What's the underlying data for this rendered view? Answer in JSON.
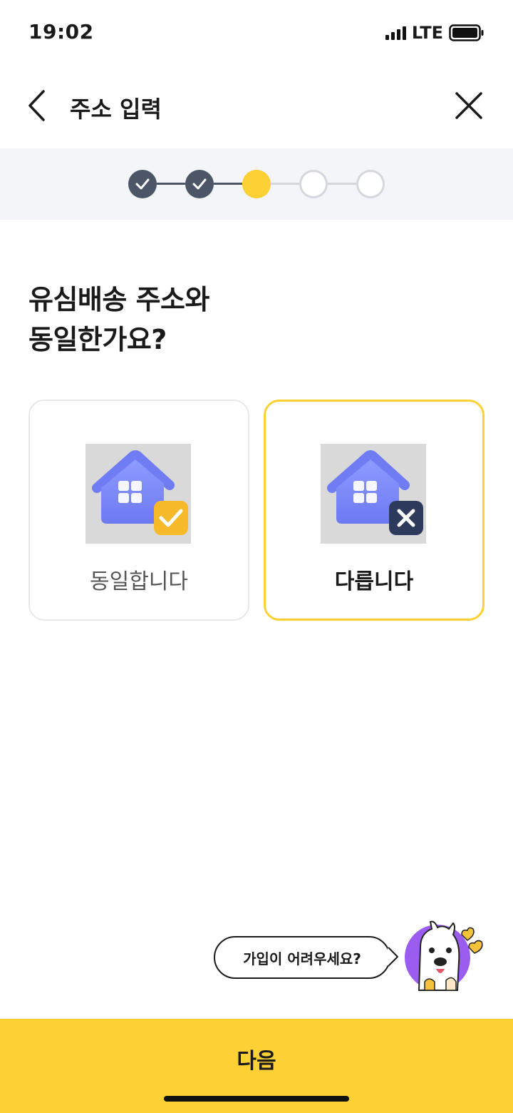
{
  "status_bar": {
    "time": "19:02",
    "network": "LTE",
    "icons": [
      "signal-icon",
      "battery-icon"
    ]
  },
  "header": {
    "title": "주소 입력",
    "back_icon": "chevron-left-icon",
    "close_icon": "close-icon"
  },
  "stepper": {
    "total_steps": 5,
    "current_step": 3,
    "states": [
      "done",
      "done",
      "current",
      "todo",
      "todo"
    ],
    "colors": {
      "done": "#4d5666",
      "current": "#fdd034",
      "todo": "#d5d7dc"
    }
  },
  "question": {
    "line1": "유심배송 주소와",
    "line2": "동일한가요?"
  },
  "options": {
    "same": {
      "label": "동일합니다",
      "icon": "house-check-icon",
      "selected": false
    },
    "different": {
      "label": "다릅니다",
      "icon": "house-x-icon",
      "selected": true
    }
  },
  "help": {
    "text": "가입이 어려우세요?",
    "mascot_icon": "mascot-icon"
  },
  "footer": {
    "next_label": "다음"
  },
  "colors": {
    "accent": "#fdd034",
    "dark": "#4d5666",
    "house_blue": "#7f8cff",
    "mascot_purple": "#9b5cf0"
  }
}
